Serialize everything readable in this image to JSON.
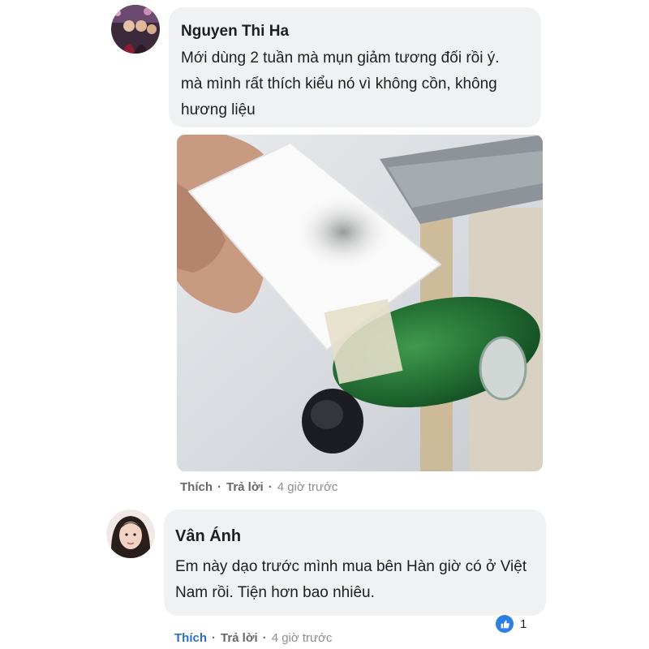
{
  "comments": [
    {
      "author": "Nguyen Thi Ha",
      "lines": [
        "Mới dùng 2 tuần mà mụn giảm tương đối rồi ý.",
        "mà mình rất thích kiểu nó vì không cồn, không",
        "hương liệu"
      ],
      "actions": {
        "like": "Thích",
        "reply": "Trả lời",
        "time": "4 giờ trước"
      }
    },
    {
      "author": "Vân Ánh",
      "lines": [
        "Em này dạo trước mình mua bên Hàn giờ có ở Việt",
        "Nam rồi. Tiện hơn bao nhiêu."
      ],
      "actions": {
        "like": "Thích",
        "reply": "Trả lời",
        "time": "4 giờ trước"
      },
      "reaction_count": "1"
    }
  ],
  "colors": {
    "bubble": "#eff1f3",
    "like_active": "#2d6ec4",
    "reaction": "#2d7fe3"
  }
}
